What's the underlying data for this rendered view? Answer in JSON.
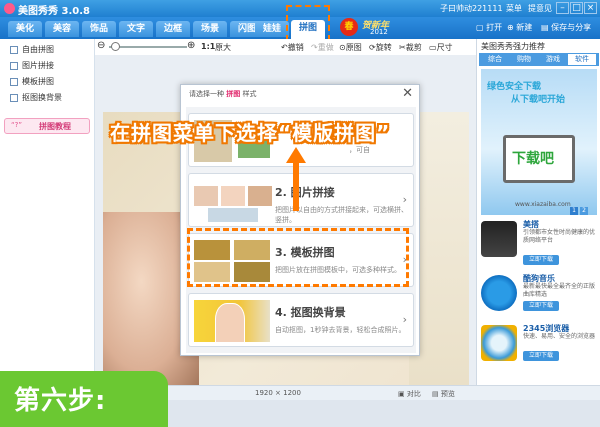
{
  "app": {
    "title": "美图秀秀 3.0.8",
    "user": "子曰帅动221111",
    "menu_label": "菜单",
    "feedback_label": "提意见"
  },
  "tabs": [
    {
      "label": "美化"
    },
    {
      "label": "美容"
    },
    {
      "label": "饰品"
    },
    {
      "label": "文字"
    },
    {
      "label": "边框"
    },
    {
      "label": "场景"
    },
    {
      "label": "闪图"
    },
    {
      "label": "娃娃"
    },
    {
      "label": "拼图"
    }
  ],
  "festival": {
    "badge": "春",
    "text": "贺新年",
    "year": "2012"
  },
  "tabbar_actions": {
    "open": "打开",
    "new": "新建",
    "save_share": "保存与分享"
  },
  "sidebar": {
    "items": [
      {
        "label": "自由拼图"
      },
      {
        "label": "图片拼接"
      },
      {
        "label": "模板拼图"
      },
      {
        "label": "抠图换背景"
      }
    ],
    "tutorial": {
      "icon_text": "“?”",
      "label": "拼图教程"
    }
  },
  "toolbar": {
    "zoom_ratio": "1:1",
    "zoom_label": "原大",
    "undo": "撤销",
    "redo": "重做",
    "original": "原图",
    "rotate": "旋转",
    "crop": "裁剪",
    "size": "尺寸"
  },
  "dialog": {
    "header_pre": "请选择一种",
    "header_highlight": "拼图",
    "header_post": "样式",
    "options": [
      {
        "title": "",
        "desc": "，可自"
      },
      {
        "title": "2. 图片拼接",
        "desc": "把图片以自由的方式拼接起来，可选横拼、竖拼。"
      },
      {
        "title": "3. 模板拼图",
        "desc": "把图片放在拼图模板中，可选多种样式。"
      },
      {
        "title": "4. 抠图换背景",
        "desc": "自动抠图，1秒钟去背景，轻松合成照片。"
      }
    ]
  },
  "annotation": "在拼图菜单下选择“模版拼图”",
  "right_panel": {
    "title": "美图秀秀强力推荐",
    "tabs": [
      {
        "label": "综合"
      },
      {
        "label": "购物"
      },
      {
        "label": "游戏"
      },
      {
        "label": "软件"
      }
    ],
    "banner": {
      "line1": "绿色安全下载",
      "line2": "从下载吧开始",
      "logo_text": "下载吧",
      "url": "www.xiazaiba.com",
      "page1": "1",
      "page2": "2"
    },
    "apps": [
      {
        "name": "美搭",
        "desc": "引领都市女性时尚健康的优质网络平台",
        "button": "立即下载"
      },
      {
        "name": "酷狗音乐",
        "desc": "最新最快最全最齐全的正版曲库精选",
        "button": "立即下载"
      },
      {
        "name": "2345浏览器",
        "desc": "快速、易用、安全的浏览器",
        "button": "立即下载"
      }
    ]
  },
  "status": {
    "dimensions": "1920 × 1200",
    "compare": "对比",
    "preview": "预览"
  },
  "step_badge": "第六步:",
  "colors": {
    "accent_blue": "#1f7fd0",
    "highlight_orange": "#ff7a00",
    "step_green": "#6bc832",
    "pink": "#e0276b"
  }
}
